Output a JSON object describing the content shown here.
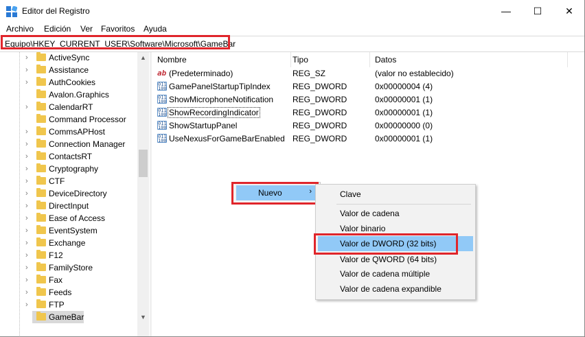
{
  "window": {
    "title": "Editor del Registro",
    "controls": {
      "minimize": "—",
      "maximize": "☐",
      "close": "✕"
    }
  },
  "menu": [
    "Archivo",
    "Edición",
    "Ver",
    "Favoritos",
    "Ayuda"
  ],
  "address": "Equipo\\HKEY_CURRENT_USER\\Software\\Microsoft\\GameBar",
  "tree": {
    "items": [
      {
        "label": "ActiveSync",
        "expandable": true
      },
      {
        "label": "Assistance",
        "expandable": true
      },
      {
        "label": "AuthCookies",
        "expandable": true
      },
      {
        "label": "Avalon.Graphics",
        "expandable": false
      },
      {
        "label": "CalendarRT",
        "expandable": true
      },
      {
        "label": "Command Processor",
        "expandable": false
      },
      {
        "label": "CommsAPHost",
        "expandable": true
      },
      {
        "label": "Connection Manager",
        "expandable": true
      },
      {
        "label": "ContactsRT",
        "expandable": true
      },
      {
        "label": "Cryptography",
        "expandable": true
      },
      {
        "label": "CTF",
        "expandable": true
      },
      {
        "label": "DeviceDirectory",
        "expandable": true
      },
      {
        "label": "DirectInput",
        "expandable": true
      },
      {
        "label": "Ease of Access",
        "expandable": true
      },
      {
        "label": "EventSystem",
        "expandable": true
      },
      {
        "label": "Exchange",
        "expandable": true
      },
      {
        "label": "F12",
        "expandable": true
      },
      {
        "label": "FamilyStore",
        "expandable": true
      },
      {
        "label": "Fax",
        "expandable": true
      },
      {
        "label": "Feeds",
        "expandable": true
      },
      {
        "label": "FTP",
        "expandable": true
      },
      {
        "label": "GameBar",
        "expandable": false,
        "selected": true
      }
    ]
  },
  "list": {
    "columns": {
      "name": "Nombre",
      "type": "Tipo",
      "data": "Datos"
    },
    "rows": [
      {
        "icon": "ab",
        "name": "(Predeterminado)",
        "type": "REG_SZ",
        "data": "(valor no establecido)"
      },
      {
        "icon": "bin",
        "name": "GamePanelStartupTipIndex",
        "type": "REG_DWORD",
        "data": "0x00000004 (4)"
      },
      {
        "icon": "bin",
        "name": "ShowMicrophoneNotification",
        "type": "REG_DWORD",
        "data": "0x00000001 (1)"
      },
      {
        "icon": "bin",
        "name": "ShowRecordingIndicator",
        "type": "REG_DWORD",
        "data": "0x00000001 (1)",
        "focused": true
      },
      {
        "icon": "bin",
        "name": "ShowStartupPanel",
        "type": "REG_DWORD",
        "data": "0x00000000 (0)"
      },
      {
        "icon": "bin",
        "name": "UseNexusForGameBarEnabled",
        "type": "REG_DWORD",
        "data": "0x00000001 (1)"
      }
    ]
  },
  "context_menu": {
    "nuevo_label": "Nuevo",
    "submenu": {
      "clave": "Clave",
      "cadena": "Valor de cadena",
      "binario": "Valor binario",
      "dword": "Valor de DWORD (32 bits)",
      "qword": "Valor de QWORD (64 bits)",
      "multi": "Valor de cadena múltiple",
      "expandible": "Valor de cadena expandible"
    }
  },
  "colors": {
    "highlight_box": "#e0252b",
    "menu_hover": "#91c9f7",
    "folder": "#f0c64d"
  }
}
